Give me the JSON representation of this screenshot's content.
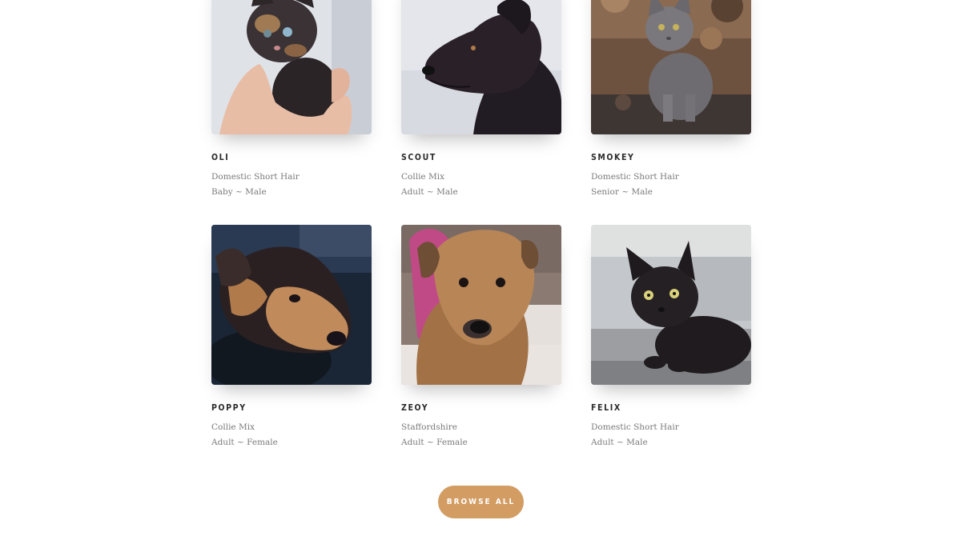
{
  "pets": [
    {
      "name": "OLI",
      "breed": "Domestic Short Hair",
      "age": "Baby",
      "sex": "Male",
      "photo": "kitten-in-hand"
    },
    {
      "name": "SCOUT",
      "breed": "Collie Mix",
      "age": "Adult",
      "sex": "Male",
      "photo": "black-dog-profile"
    },
    {
      "name": "SMOKEY",
      "breed": "Domestic Short Hair",
      "age": "Senior",
      "sex": "Male",
      "photo": "gray-cat-sitting"
    },
    {
      "name": "POPPY",
      "breed": "Collie Mix",
      "age": "Adult",
      "sex": "Female",
      "photo": "tricolor-dog-face"
    },
    {
      "name": "ZEOY",
      "breed": "Staffordshire",
      "age": "Adult",
      "sex": "Female",
      "photo": "tan-dog-harness"
    },
    {
      "name": "FELIX",
      "breed": "Domestic Short Hair",
      "age": "Adult",
      "sex": "Male",
      "photo": "black-kitten"
    }
  ],
  "meta_separator": " ~ ",
  "browse_button": {
    "label": "BROWSE ALL"
  },
  "colors": {
    "accent": "#d29c62",
    "name_text": "#2b2b2b",
    "meta_text": "#7a7a7a"
  }
}
